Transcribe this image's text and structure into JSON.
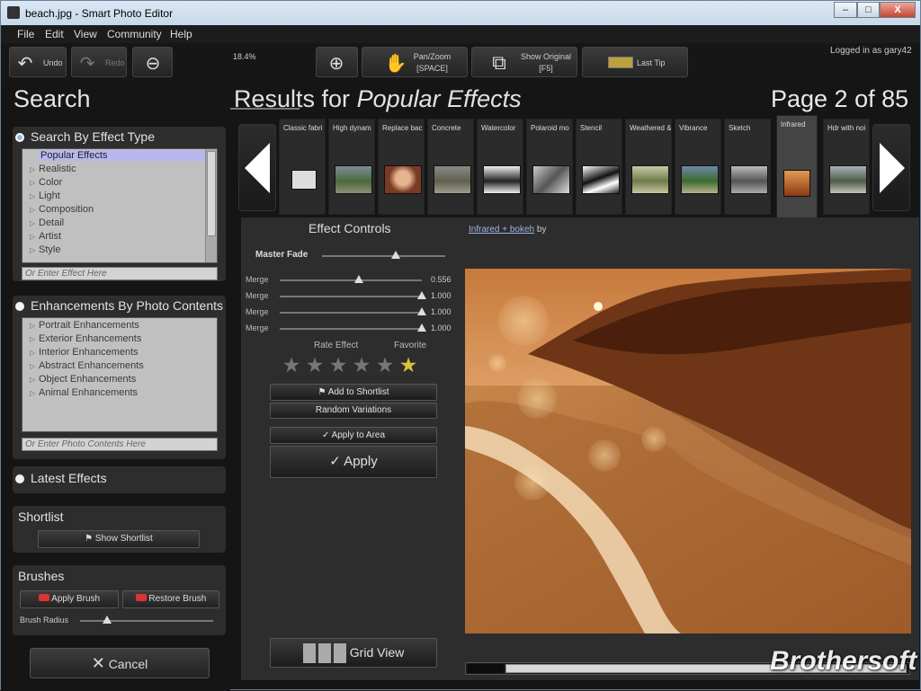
{
  "window": {
    "title": "beach.jpg - Smart Photo Editor",
    "controls": [
      "–",
      "□",
      "X"
    ]
  },
  "menu": [
    "File",
    "Edit",
    "View",
    "Community",
    "Help"
  ],
  "toolbar": {
    "undo": "Undo",
    "redo": "Redo",
    "zoom_pct": "18.4%",
    "zoom_level": 0.0,
    "panzoom": "Pan/Zoom",
    "panzoom_key": "[SPACE]",
    "show_original": "Show Original",
    "show_original_key": "[F5]",
    "last_tip": "Last Tip",
    "login": "Logged in as gary42"
  },
  "left": {
    "search_title": "Search",
    "effect_type": {
      "title": "Search By Effect Type",
      "items": [
        "Popular Effects",
        "Realistic",
        "Color",
        "Light",
        "Composition",
        "Detail",
        "Artist",
        "Style"
      ],
      "placeholder": "Or Enter Effect Here"
    },
    "enhancements": {
      "title": "Enhancements By Photo Contents",
      "items": [
        "Portrait Enhancements",
        "Exterior Enhancements",
        "Interior Enhancements",
        "Abstract Enhancements",
        "Object Enhancements",
        "Animal Enhancements"
      ],
      "placeholder": "Or Enter Photo Contents Here"
    },
    "latest": "Latest Effects",
    "shortlist": {
      "title": "Shortlist",
      "button": "Show Shortlist"
    },
    "brushes": {
      "title": "Brushes",
      "apply": "Apply Brush",
      "restore": "Restore Brush",
      "radius_label": "Brush Radius",
      "radius": 0.2
    },
    "cancel": "Cancel"
  },
  "results": {
    "prefix": "Results for",
    "query": "Popular Effects",
    "page": "Page 2 of 85",
    "thumbs": [
      "Classic fabri",
      "High dynam",
      "Replace bac",
      "Concrete",
      "Watercolor",
      "Polaroid mo",
      "Stencil",
      "Weathered &",
      "Vibrance",
      "Sketch",
      "Infrared",
      "Hdr with noi"
    ]
  },
  "effect": {
    "title": "Effect Controls",
    "link": "Infrared + bokeh",
    "link_suffix": "by",
    "master_label": "Master Fade",
    "master_value": 0.6,
    "sliders": [
      {
        "label": "Merge",
        "value": "0.556",
        "level": 0.556
      },
      {
        "label": "Merge",
        "value": "1.000",
        "level": 1.0
      },
      {
        "label": "Merge",
        "value": "1.000",
        "level": 1.0
      },
      {
        "label": "Merge",
        "value": "1.000",
        "level": 1.0
      }
    ],
    "rate_label": "Rate Effect",
    "favorite_label": "Favorite",
    "rating": "0 of 5",
    "favorited": true,
    "add_shortlist": "Add to Shortlist",
    "random": "Random Variations",
    "apply_area": "Apply to Area",
    "apply": "Apply",
    "grid_view": "Grid View"
  },
  "watermark": "Brothersoft",
  "colors": {
    "selection": "#b8b8ee",
    "favorite": "#d8c23a",
    "link": "#9fb4e6"
  }
}
